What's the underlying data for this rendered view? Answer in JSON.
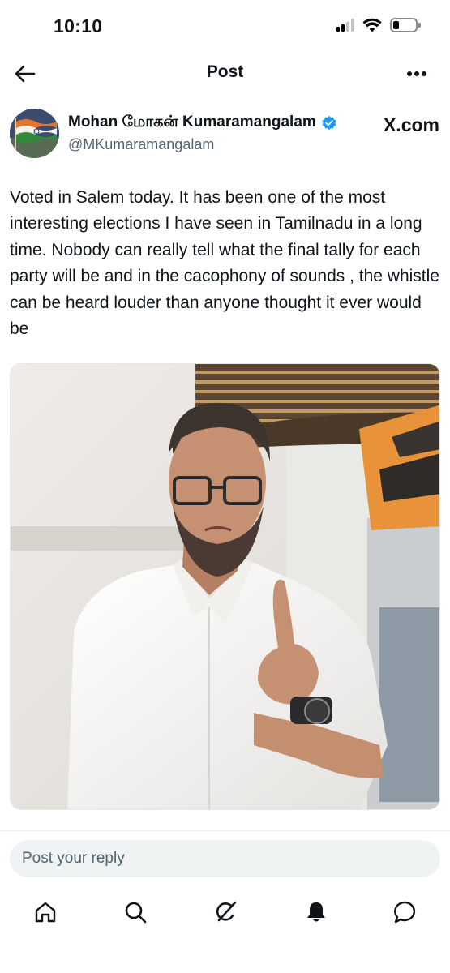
{
  "status_bar": {
    "time": "10:10",
    "signal_icon": "cellular-signal-icon",
    "wifi_icon": "wifi-icon",
    "battery_icon": "battery-low-icon"
  },
  "header": {
    "title": "Post",
    "back_icon": "back-arrow-icon",
    "more_icon": "more-horizontal-icon"
  },
  "post": {
    "author": {
      "name": "Mohan மோகன் Kumaramangalam",
      "handle": "@MKumaramangalam",
      "verified_icon": "verified-badge-icon",
      "avatar": "indian-flag-avatar"
    },
    "watermark": "X.com",
    "text": "Voted in Salem today. It has been one of the most interesting  elections I have seen in Tamilnadu in a long time. Nobody can really tell what the final tally for each party will be and in the cacophony of sounds , the whistle can be heard louder than anyone thought it ever would be",
    "image": "photo-man-showing-inked-finger"
  },
  "reply": {
    "placeholder": "Post your reply"
  },
  "tabbar": {
    "items": [
      {
        "name": "home",
        "icon": "home-icon"
      },
      {
        "name": "search",
        "icon": "search-icon"
      },
      {
        "name": "grok",
        "icon": "grok-icon"
      },
      {
        "name": "notifications",
        "icon": "bell-icon"
      },
      {
        "name": "messages",
        "icon": "chat-bubble-icon"
      }
    ]
  },
  "colors": {
    "text": "#0f1419",
    "secondary": "#536471",
    "verified": "#1d9bf0",
    "input_bg": "#eff3f4"
  }
}
